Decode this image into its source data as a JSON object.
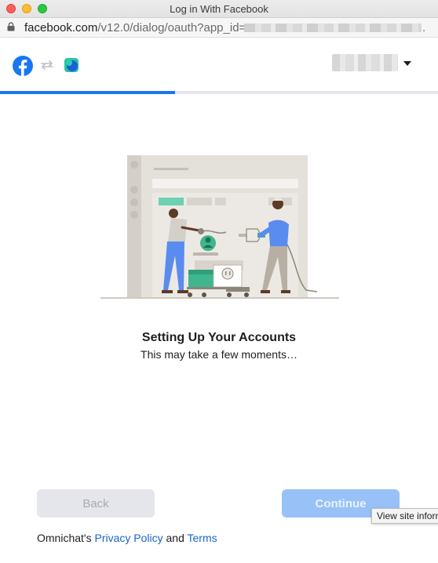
{
  "window": {
    "title": "Log in With Facebook"
  },
  "address_bar": {
    "domain": "facebook.com",
    "path": "/v12.0/dialog/oauth?app_id=",
    "trailing": "."
  },
  "header": {
    "icons": [
      "facebook-logo-icon",
      "swap-arrows-icon",
      "omnichat-logo-icon"
    ],
    "account_menu_icon": "caret-down-icon"
  },
  "progress": {
    "fraction": 0.4,
    "color": "#1877f2"
  },
  "main": {
    "heading": "Setting Up Your Accounts",
    "subheading": "This may take a few moments…"
  },
  "buttons": {
    "back": "Back",
    "continue": "Continue"
  },
  "tooltip": {
    "text": "View site inforn"
  },
  "footer": {
    "prefix": "Omnichat's",
    "privacy": "Privacy Policy",
    "and": "and",
    "terms": "Terms"
  },
  "colors": {
    "accent": "#1877f2",
    "link": "#1764c9"
  }
}
